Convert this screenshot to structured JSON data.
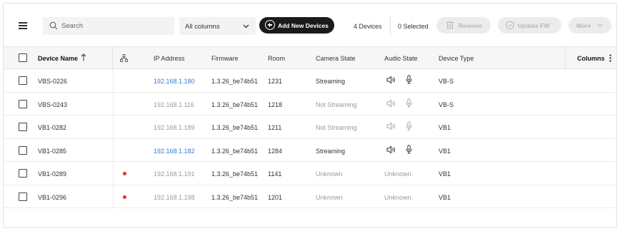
{
  "toolbar": {
    "search_placeholder": "Search",
    "columns_select": "All columns",
    "add_label": "Add New Devices",
    "device_count": "4 Devices",
    "selected_count": "0 Selected",
    "remove_label": "Remove",
    "update_label": "Update FW",
    "more_label": "More"
  },
  "table": {
    "headers": {
      "name": "Device Name",
      "ip": "IP Address",
      "firmware": "Firmware",
      "room": "Room",
      "camera": "Camera State",
      "audio": "Audio State",
      "type": "Device Type",
      "columns": "Columns"
    },
    "rows": [
      {
        "name": "VBS-0226",
        "ip": "192.168.1.180",
        "firmware": "1.3.26_be74b51",
        "room": "1231",
        "camera": "Streaming",
        "audio": "",
        "type": "VB-S"
      },
      {
        "name": "VBS-0243",
        "ip": "192.168.1.116",
        "firmware": "1.3.26_be74b51",
        "room": "1218",
        "camera": "Not Streaming",
        "audio": "",
        "type": "VB-S"
      },
      {
        "name": "VB1-0282",
        "ip": "192.168.1.189",
        "firmware": "1.3.26_be74b51",
        "room": "1211",
        "camera": "Not Streaming",
        "audio": "",
        "type": "VB1"
      },
      {
        "name": "VB1-0285",
        "ip": "192.168.1.182",
        "firmware": "1.3.26_be74b51",
        "room": "1284",
        "camera": "Streaming",
        "audio": "",
        "type": "VB1"
      },
      {
        "name": "VB1-0289",
        "ip": "192.168.1.191",
        "firmware": "1.3.26_be74b51",
        "room": "1141",
        "camera": "Unknown",
        "audio": "Unknown",
        "type": "VB1"
      },
      {
        "name": "VB1-0296",
        "ip": "192.168.1.198",
        "firmware": "1.3.26_be74b51",
        "room": "1201",
        "camera": "Unknown",
        "audio": "Unknown",
        "type": "VB1"
      }
    ]
  },
  "colors": {
    "link": "#2b7fd4",
    "alert_dot": "#e0322f",
    "primary_button": "#1a1a1a"
  }
}
